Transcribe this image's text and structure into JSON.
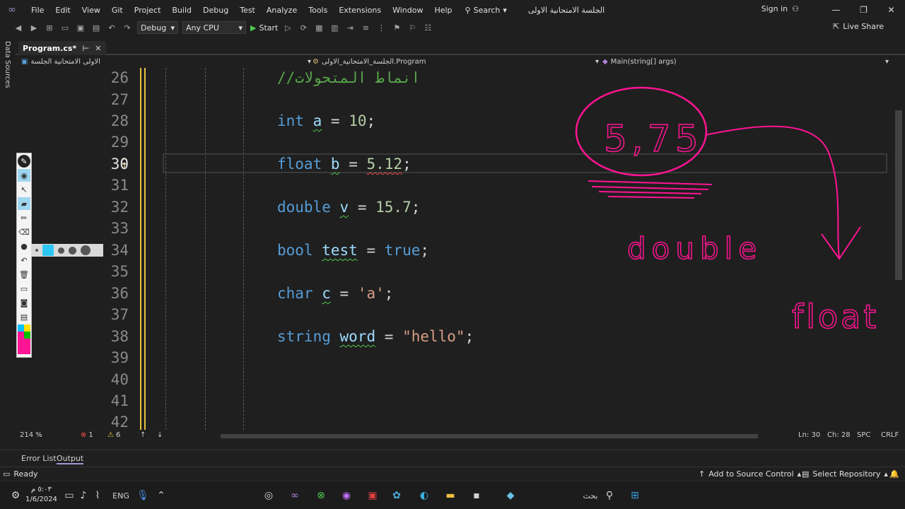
{
  "menu": {
    "items": [
      "File",
      "Edit",
      "View",
      "Git",
      "Project",
      "Build",
      "Debug",
      "Test",
      "Analyze",
      "Tools",
      "Extensions",
      "Window",
      "Help"
    ],
    "search_label": "Search",
    "solution_name": "الجلسة الامتحانية الاولى",
    "signin_label": "Sign in"
  },
  "toolbar": {
    "config": "Debug",
    "platform": "Any CPU",
    "start_label": "Start",
    "live_share_label": "Live Share"
  },
  "left_rail": {
    "data_sources_label": "Data Sources"
  },
  "tabs": {
    "active_tab": "Program.cs*"
  },
  "navbar": {
    "project": "الاولى الامتحانية الجلسة",
    "class": "الجلسة_الامتحانية_الاولى.Program",
    "member": "Main(string[] args)"
  },
  "editor": {
    "line_numbers": [
      "26",
      "27",
      "28",
      "29",
      "30",
      "31",
      "32",
      "33",
      "34",
      "35",
      "36",
      "37",
      "38",
      "39",
      "40",
      "41",
      "42"
    ],
    "comment_text": "//انماط المتحولات",
    "line_int": {
      "kw": "int",
      "id": "a",
      "eq": "=",
      "val": "10",
      "end": ";"
    },
    "line_float": {
      "kw": "float",
      "id": "b",
      "eq": "=",
      "val": "5.12",
      "end": ";"
    },
    "line_double": {
      "kw": "double",
      "id": "v",
      "eq": "=",
      "val": "15.7",
      "end": ";"
    },
    "line_bool": {
      "kw": "bool",
      "id": "test",
      "eq": "=",
      "val": "true",
      "end": ";"
    },
    "line_char": {
      "kw": "char",
      "id": "c",
      "eq": "=",
      "val": "'a'",
      "end": ";"
    },
    "line_string": {
      "kw": "string",
      "id": "word",
      "eq": "=",
      "val": "\"hello\"",
      "end": ";"
    }
  },
  "ink_annotations": {
    "circled_number": "5,75",
    "word_double": "double",
    "word_float": "float",
    "ink_color": "#ff1493"
  },
  "bottom_bar": {
    "zoom": "214 %",
    "errors": "1",
    "warnings": "6",
    "line": "Ln: 30",
    "col": "Ch: 28",
    "spacing": "SPC",
    "line_ending": "CRLF"
  },
  "bottom_tabs": {
    "error_list": "Error List",
    "output": "Output"
  },
  "status": {
    "ready": "Ready",
    "add_source_control": "Add to Source Control",
    "select_repository": "Select Repository"
  },
  "taskbar": {
    "time": "٥:٠٣ م",
    "date": "1/6/2024",
    "lang": "ENG",
    "search_label": "بحث"
  },
  "colors": {
    "keyword": "#569cd6",
    "identifier": "#9cdcfe",
    "number": "#b5cea8",
    "string": "#d69d85",
    "accent_yellow": "#e8c33a"
  }
}
